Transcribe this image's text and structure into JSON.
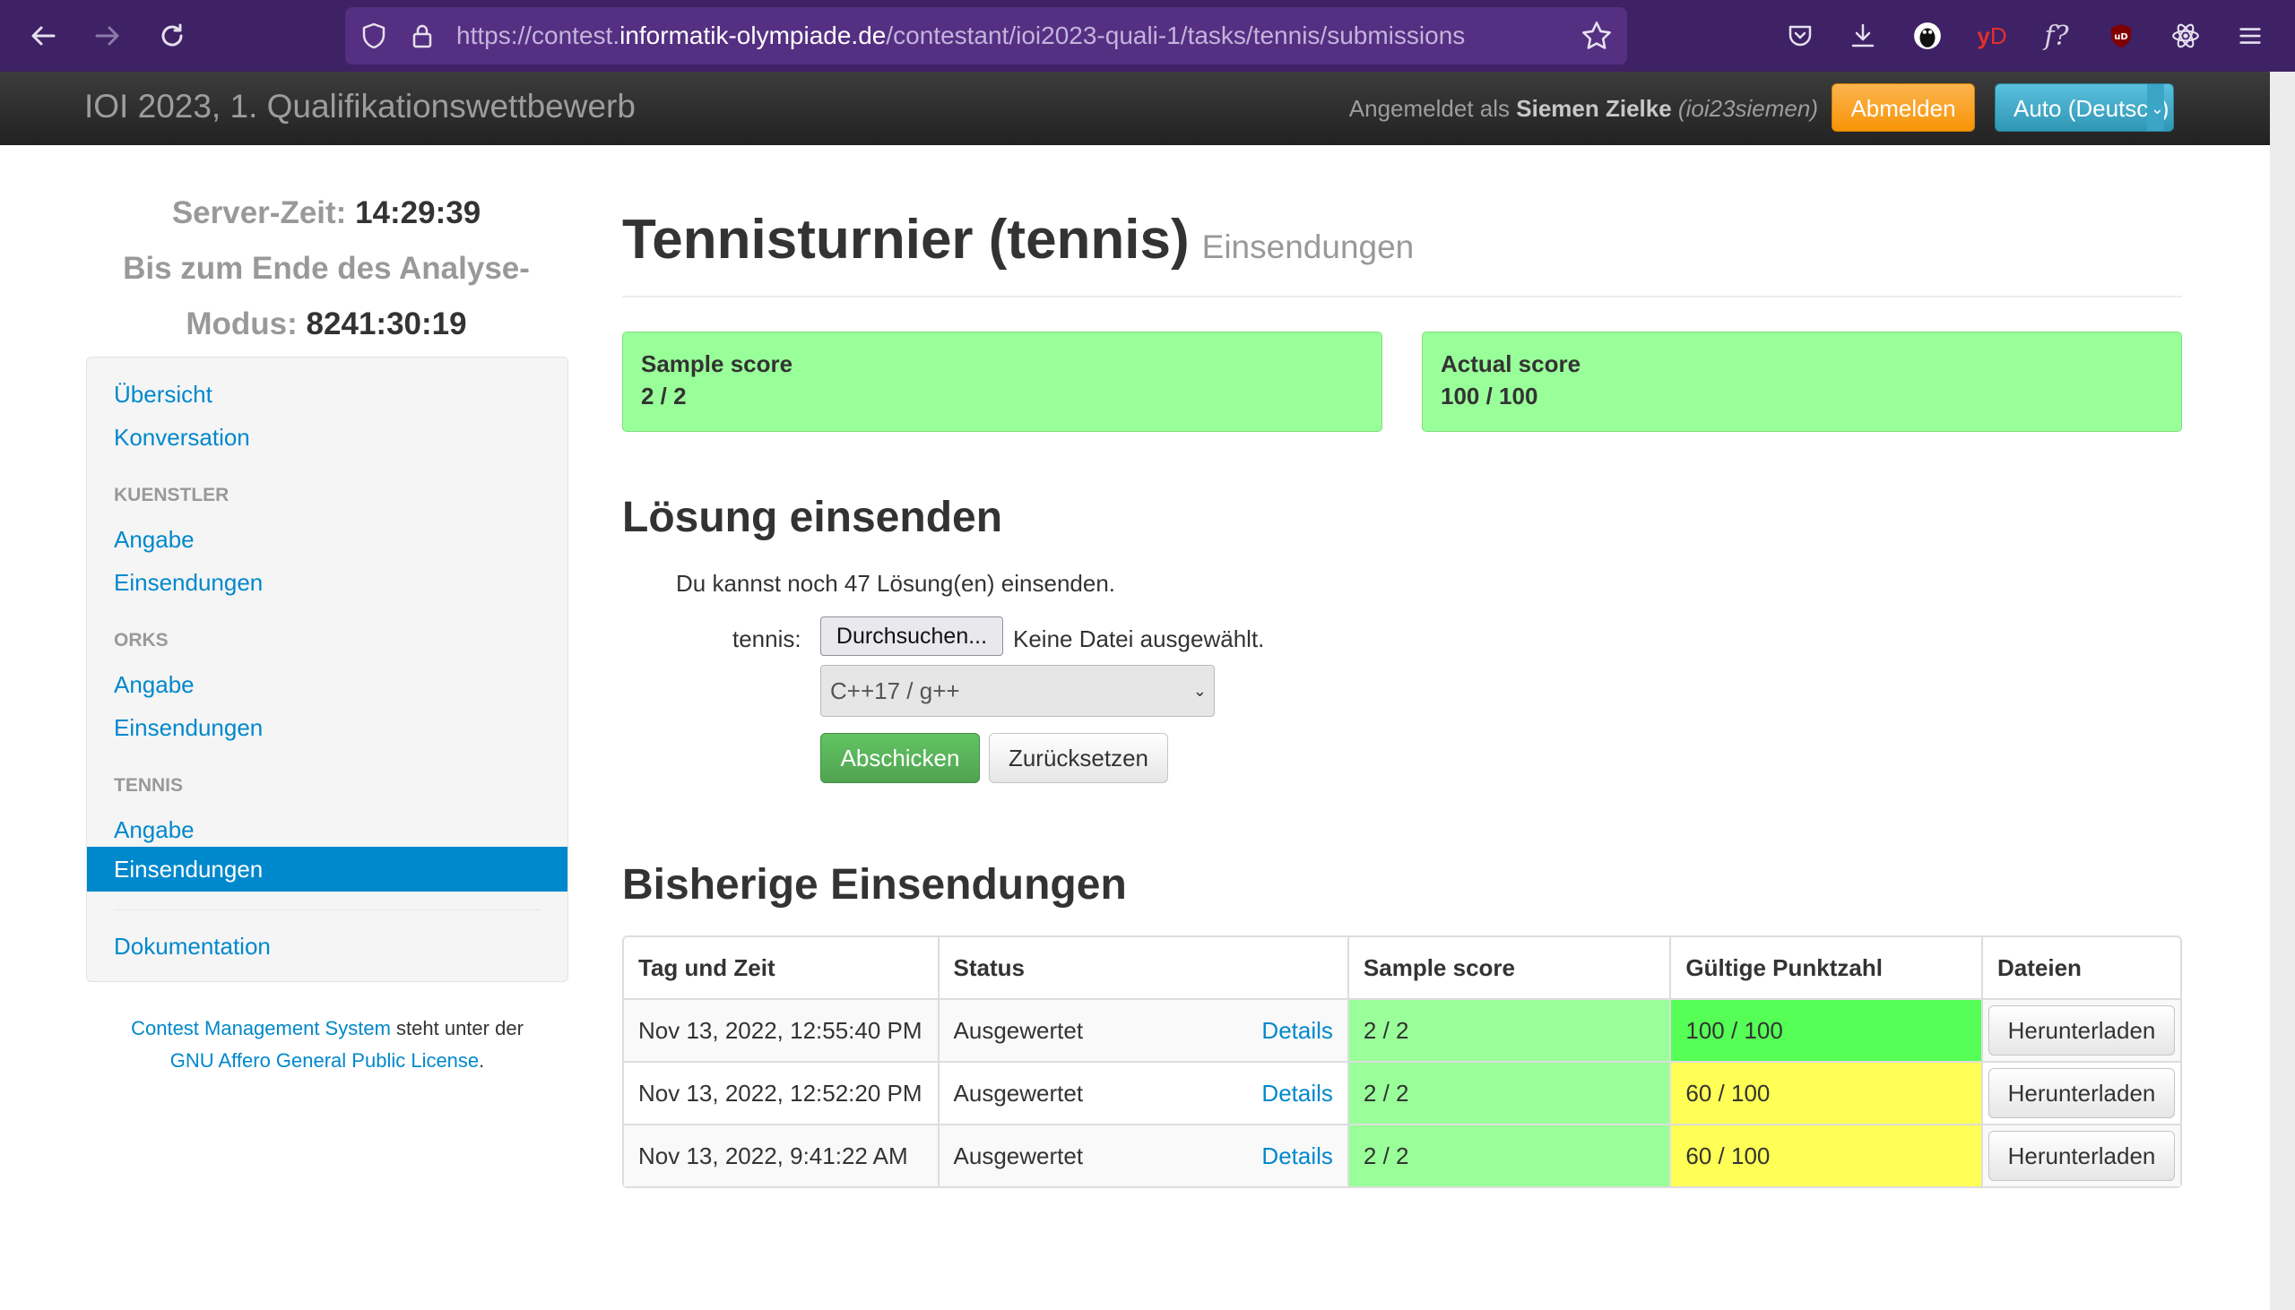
{
  "browser": {
    "url_prefix": "https://contest.",
    "url_domain": "informatik-olympiade.de",
    "url_path": "/contestant/ioi2023-quali-1/tasks/tennis/submissions"
  },
  "navbar": {
    "contest_title": "IOI 2023, 1. Qualifikationswettbewerb",
    "logged_in_prefix": "Angemeldet als",
    "user_name": "Siemen Zielke",
    "user_handle": "(ioi23siemen)",
    "logout_label": "Abmelden",
    "language_label": "Auto (Deutsch)"
  },
  "clock": {
    "server_time_label": "Server-Zeit:",
    "server_time": "14:29:39",
    "analysis_label_1": "Bis zum Ende des Analyse-",
    "analysis_label_2": "Modus:",
    "analysis_time": "8241:30:19"
  },
  "sidebar": {
    "overview": "Übersicht",
    "conversation": "Konversation",
    "tasks": [
      {
        "header": "KUENSTLER",
        "statement": "Angabe",
        "submissions": "Einsendungen"
      },
      {
        "header": "ORKS",
        "statement": "Angabe",
        "submissions": "Einsendungen"
      },
      {
        "header": "TENNIS",
        "statement": "Angabe",
        "submissions": "Einsendungen"
      }
    ],
    "documentation": "Dokumentation"
  },
  "footer": {
    "cms_link": "Contest Management System",
    "text_middle": "steht unter der",
    "license_link": "GNU Affero General Public License",
    "text_end": "."
  },
  "main": {
    "task_title": "Tennisturnier (tennis)",
    "task_subtitle": "Einsendungen",
    "sample_score_label": "Sample score",
    "sample_score_value": "2 / 2",
    "actual_score_label": "Actual score",
    "actual_score_value": "100 / 100",
    "submit_heading": "Lösung einsenden",
    "remaining_text": "Du kannst noch 47 Lösung(en) einsenden.",
    "file_label": "tennis:",
    "browse_label": "Durchsuchen...",
    "no_file_label": "Keine Datei ausgewählt.",
    "language_selected": "C++17 / g++",
    "submit_label": "Abschicken",
    "reset_label": "Zurücksetzen",
    "previous_heading": "Bisherige Einsendungen"
  },
  "table": {
    "headers": [
      "Tag und Zeit",
      "Status",
      "Sample score",
      "Gültige Punktzahl",
      "Dateien"
    ],
    "rows": [
      {
        "time": "Nov 13, 2022, 12:55:40 PM",
        "status": "Ausgewertet",
        "details": "Details",
        "sample": "2 / 2",
        "score": "100 / 100",
        "score_color": "#55ff55",
        "download": "Herunterladen"
      },
      {
        "time": "Nov 13, 2022, 12:52:20 PM",
        "status": "Ausgewertet",
        "details": "Details",
        "sample": "2 / 2",
        "score": "60 / 100",
        "score_color": "#ffff55",
        "download": "Herunterladen"
      },
      {
        "time": "Nov 13, 2022, 9:41:22 AM",
        "status": "Ausgewertet",
        "details": "Details",
        "sample": "2 / 2",
        "score": "60 / 100",
        "score_color": "#ffff55",
        "download": "Herunterladen"
      }
    ]
  },
  "colors": {
    "browser_bar": "#3f2166",
    "link": "#0088cc",
    "sample_green": "#99ff99",
    "full_green": "#55ff55",
    "partial_yellow": "#ffff55"
  }
}
